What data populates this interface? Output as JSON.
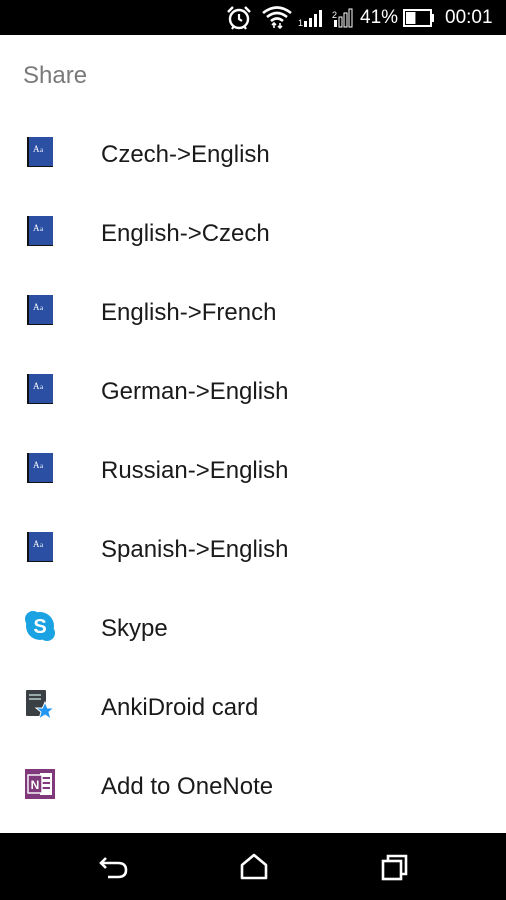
{
  "status_bar": {
    "battery_percent": "41%",
    "battery_level": 0.41,
    "time": "00:01",
    "icons": [
      "alarm-icon",
      "wifi-icon",
      "signal-icon",
      "signal-icon-2",
      "battery-icon"
    ]
  },
  "sheet": {
    "title": "Share",
    "items": [
      {
        "label": "Czech->English",
        "icon": "dictionary-book-icon"
      },
      {
        "label": "English->Czech",
        "icon": "dictionary-book-icon"
      },
      {
        "label": "English->French",
        "icon": "dictionary-book-icon"
      },
      {
        "label": "German->English",
        "icon": "dictionary-book-icon"
      },
      {
        "label": "Russian->English",
        "icon": "dictionary-book-icon"
      },
      {
        "label": "Spanish->English",
        "icon": "dictionary-book-icon"
      },
      {
        "label": "Skype",
        "icon": "skype-icon"
      },
      {
        "label": "AnkiDroid card",
        "icon": "ankidroid-icon"
      },
      {
        "label": "Add to OneNote",
        "icon": "onenote-icon"
      }
    ]
  },
  "nav_bar": {
    "buttons": [
      "back-icon",
      "home-icon",
      "recents-icon"
    ]
  },
  "colors": {
    "book_blue": "#2a4fa3",
    "skype_blue": "#1ba2e2",
    "onenote_purple": "#80397b",
    "anki_star": "#2196f3"
  }
}
